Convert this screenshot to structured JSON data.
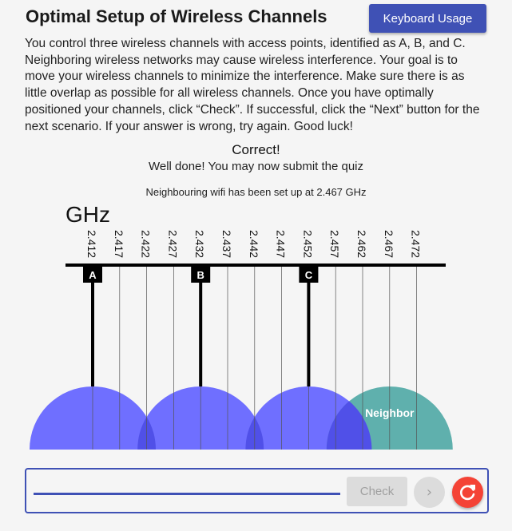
{
  "header": {
    "title": "Optimal Setup of Wireless Channels",
    "keyboard_button": "Keyboard Usage"
  },
  "instructions": "You control three wireless channels with access points, identified as A, B, and C. Neighboring wireless networks may cause wireless interference. Your goal is to move your wireless channels to minimize the interference. Make sure there is as little overlap as possible for all wireless channels. Once you have optimally positioned your channels, click “Check”. If successful, click the “Next” button for the next scenario. If your answer is wrong, try again. Good luck!",
  "feedback": {
    "title": "Correct!",
    "message": "Well done! You may now submit the quiz"
  },
  "neighbor_note": "Neighbouring wifi has been set up at 2.467 GHz",
  "spectrum": {
    "unit_label": "GHz",
    "frequencies": [
      "2.412",
      "2.417",
      "2.422",
      "2.427",
      "2.432",
      "2.437",
      "2.442",
      "2.447",
      "2.452",
      "2.457",
      "2.462",
      "2.467",
      "2.472"
    ],
    "channels": [
      {
        "label": "A",
        "frequency": "2.412"
      },
      {
        "label": "B",
        "frequency": "2.432"
      },
      {
        "label": "C",
        "frequency": "2.452"
      }
    ],
    "neighbor": {
      "label": "Neighbor",
      "frequency": "2.467"
    },
    "colors": {
      "channel": "#6f6fff",
      "neighbor": "#5fb0ad",
      "overlap": "#5050e8",
      "neighbor_label": "#ffffff"
    }
  },
  "controls": {
    "check_button": "Check",
    "next_icon": "chevron-right-icon",
    "reset_icon": "refresh-icon"
  }
}
